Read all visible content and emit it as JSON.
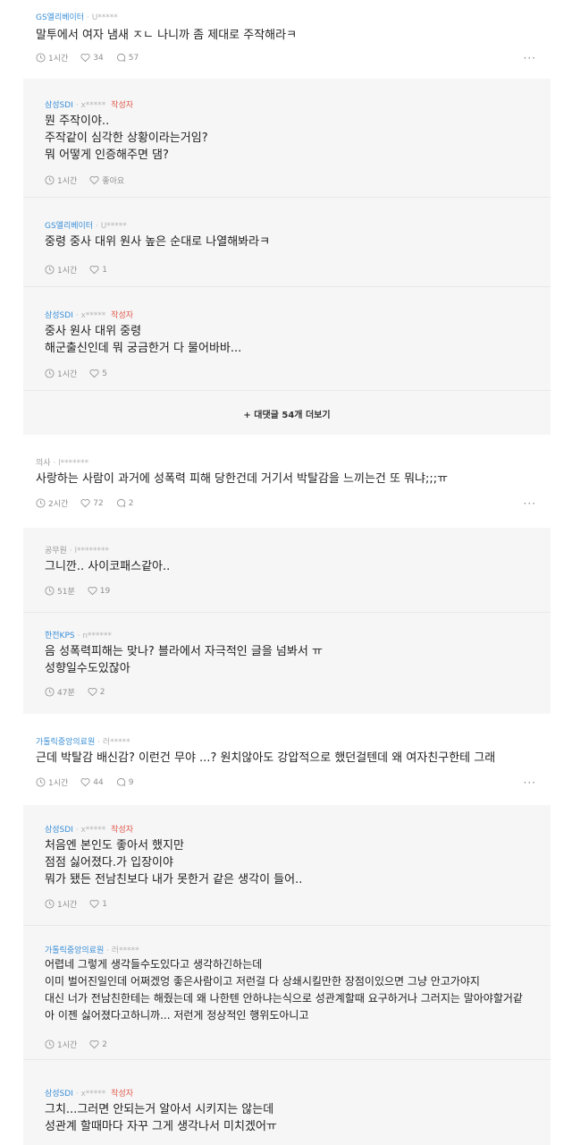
{
  "icons": {
    "clock": "clock-icon",
    "heart": "heart-icon",
    "comment": "comment-icon",
    "more": "more-icon"
  },
  "colors": {
    "company": "#3a8fd6",
    "writer_badge": "#e05a4a",
    "reply_bg": "#f6f6f7"
  },
  "more_label": "···",
  "c1": {
    "company": "GS엘리베이터",
    "user": "· U*****",
    "text": "말투에서 여자 냄새 ㅈㄴ 나니까 좀 제대로 주작해라ㅋ",
    "time": "1시간",
    "likes": "34",
    "replies": "57"
  },
  "r1": {
    "company": "삼성SDI",
    "user": "· x*****",
    "badge": "작성자",
    "lines": [
      "뭔 주작이야..",
      "주작같이 심각한 상황이라는거임?",
      "뭐 어떻게 인증해주면 댐?"
    ],
    "time": "1시간",
    "likes": "좋아요"
  },
  "r2": {
    "company": "GS엘리베이터",
    "user": "· U*****",
    "lines": [
      "중령 중사 대위 원사 높은 순대로 나열해봐라ㅋ"
    ],
    "time": "1시간",
    "likes": "1"
  },
  "r3": {
    "company": "삼성SDI",
    "user": "· x*****",
    "badge": "작성자",
    "lines": [
      "중사 원사 대위 중령",
      "해군출신인데 뭐 궁금한거 다 물어바바..."
    ],
    "time": "1시간",
    "likes": "5"
  },
  "load_more": "+ 대댓글 54개 더보기",
  "c2": {
    "company": "의사",
    "user": "· l*******",
    "text": "사랑하는 사람이 과거에 성폭력 피해 당한건데 거기서 박탈감을 느끼는건 또 뭐냐;;;ㅠ",
    "time": "2시간",
    "likes": "72",
    "replies": "2"
  },
  "r4": {
    "company": "공무원",
    "user": "· l********",
    "lines": [
      "그니깐.. 사이코패스같아.."
    ],
    "time": "51분",
    "likes": "19"
  },
  "r5": {
    "company": "한전KPS",
    "user": "· n******",
    "lines": [
      "음 성폭력피해는 맞나? 블라에서 자극적인 글을 넘봐서 ㅠ",
      "성향일수도있잖아"
    ],
    "time": "47분",
    "likes": "2"
  },
  "c3": {
    "company": "가톨릭중앙의료원",
    "user": "· 러*****",
    "text": "근데 박탈감 배신감? 이런건 무야 ...? 원치않아도 강압적으로 했던걸텐데 왜 여자친구한테 그래",
    "time": "1시간",
    "likes": "44",
    "replies": "9"
  },
  "r6": {
    "company": "삼성SDI",
    "user": "· x*****",
    "badge": "작성자",
    "lines": [
      "처음엔 본인도 좋아서 했지만",
      "점점 싫어졌다.가 입장이야",
      "뭐가 됐든 전남친보다 내가 못한거 같은 생각이 들어.."
    ],
    "time": "1시간",
    "likes": "1"
  },
  "r7": {
    "company": "가톨릭중앙의료원",
    "user": "· 러*****",
    "lines": [
      "어렵네 그렇게 생각들수도있다고 생각하긴하는데",
      "이미 벌어진일인데 어쩌겠엉 좋은사람이고 저런걸 다 상쇄시킬만한 장점이있으면 그냥 안고가야지",
      "대신 너가 전남친한테는 해줬는데 왜 나한텐 안하냐는식으로 성관계할때 요구하거나 그러지는 말아야할거같",
      "아 이젠 싫어졌다고하니까... 저런게 정상적인 행위도아니고"
    ],
    "time": "1시간",
    "likes": "2"
  },
  "r8": {
    "company": "삼성SDI",
    "user": "· x*****",
    "badge": "작성자",
    "lines": [
      "그치...그러면 안되는거 알아서 시키지는 않는데",
      "성관계 할때마다 자꾸 그게 생각나서 미치겠어ㅠ"
    ]
  }
}
